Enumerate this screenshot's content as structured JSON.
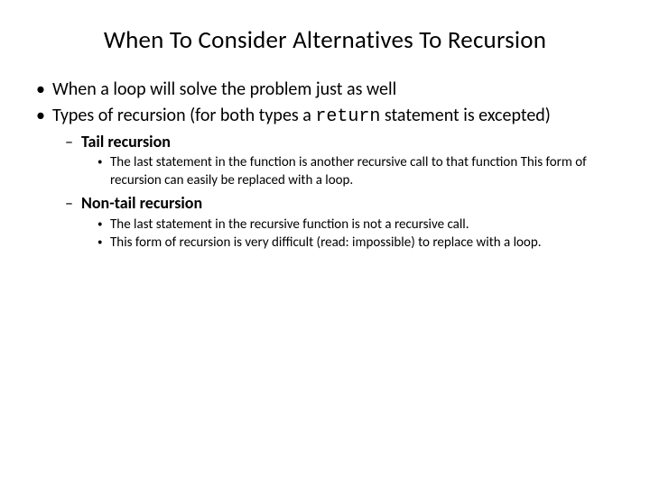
{
  "title": "When To Consider Alternatives To Recursion",
  "bullets": {
    "b1": "When a loop will solve the problem just as well",
    "b2_pre": "Types of recursion (for both types a ",
    "b2_code": "return",
    "b2_post": " statement is excepted)",
    "b2_1": "Tail recursion",
    "b2_1_1": "The last statement in the function is another recursive call to that function This form of recursion can easily be replaced with a loop.",
    "b2_2": "Non-tail recursion",
    "b2_2_1": "The last statement in the recursive function is not a recursive call.",
    "b2_2_2": "This form of recursion is very difficult (read: impossible) to replace with a loop."
  }
}
